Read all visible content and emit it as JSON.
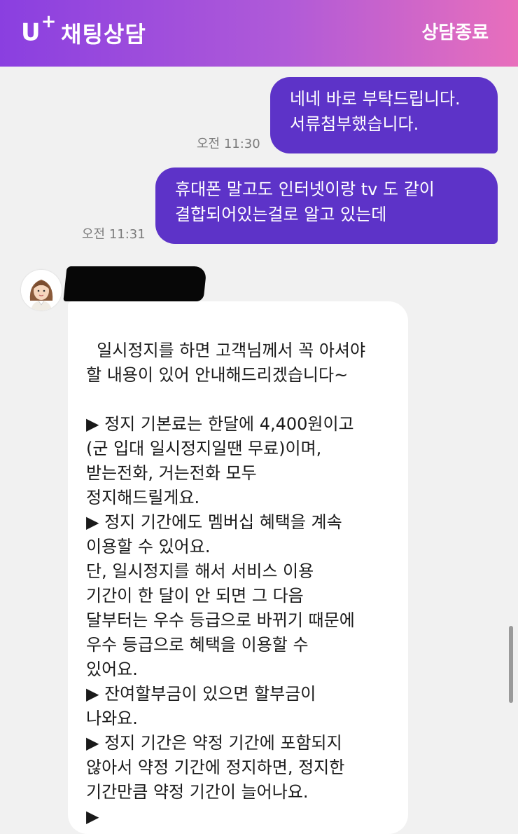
{
  "header": {
    "logo": "U",
    "logo_sup": "+",
    "title": "채팅상담",
    "end_label": "상담종료"
  },
  "messages": [
    {
      "type": "sent",
      "text": "네네 바로 부탁드립니다.\n서류첨부했습니다.",
      "time": "오전 11:30"
    },
    {
      "type": "sent",
      "text": "휴대폰 말고도 인터넷이랑 tv 도 같이\n결합되어있는걸로 알고 있는데",
      "time": "오전 11:31"
    },
    {
      "type": "received",
      "text": "일시정지를 하면 고객님께서 꼭 아셔야\n할 내용이 있어 안내해드리겠습니다~\n\n▶ 정지 기본료는 한달에 4,400원이고\n(군 입대 일시정지일땐 무료)이며,\n받는전화, 거는전화 모두\n정지해드릴게요.\n▶ 정지 기간에도 멤버십 혜택을 계속\n이용할 수 있어요.\n단, 일시정지를 해서 서비스 이용\n기간이 한 달이 안 되면 그 다음\n달부터는 우수 등급으로 바뀌기 때문에\n우수 등급으로 혜택을 이용할 수\n있어요.\n▶ 잔여할부금이 있으면 할부금이\n나와요.\n▶ 정지 기간은 약정 기간에 포함되지\n않아서 약정 기간에 정지하면, 정지한\n기간만큼 약정 기간이 늘어나요.\n▶"
    }
  ],
  "colors": {
    "header_start": "#8a3fe0",
    "header_end": "#e86fbc",
    "sent_bubble": "#5d33c8",
    "received_bubble": "#ffffff",
    "background": "#f1f1f1"
  },
  "icons": {
    "agent_avatar": "agent-avatar-icon"
  }
}
